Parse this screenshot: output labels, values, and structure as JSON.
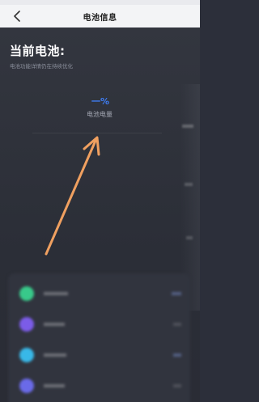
{
  "nav": {
    "title": "电池信息",
    "back_icon": "chevron-left-icon"
  },
  "battery": {
    "headline": "当前电池:",
    "subtext": "电池功能详情仍在持续优化",
    "value": "一%",
    "value_label": "电池电量"
  },
  "colors": {
    "accent": "#3f7ef5",
    "arrow": "#f0a060",
    "background": "#2c2f3a",
    "nav_background": "#f3f4f6"
  },
  "app_list": {
    "items": [
      {
        "icon_color": "#38c98a"
      },
      {
        "icon_color": "#7b5ce8"
      },
      {
        "icon_color": "#38b8e8"
      },
      {
        "icon_color": "#6a6ae8"
      }
    ]
  }
}
